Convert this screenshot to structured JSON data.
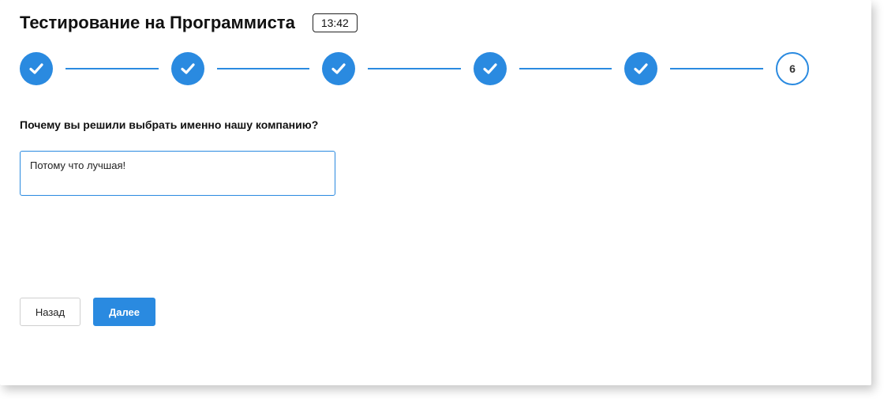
{
  "header": {
    "title": "Тестирование на Программиста",
    "timer": "13:42"
  },
  "stepper": {
    "steps": [
      {
        "state": "done",
        "icon": "check-icon"
      },
      {
        "state": "done",
        "icon": "check-icon"
      },
      {
        "state": "done",
        "icon": "check-icon"
      },
      {
        "state": "done",
        "icon": "check-icon"
      },
      {
        "state": "done",
        "icon": "check-icon"
      },
      {
        "state": "current",
        "label": "6"
      }
    ],
    "accent_color": "#2a8ae0"
  },
  "question": {
    "text": "Почему вы решили выбрать именно нашу компанию?",
    "answer_value": "Потому что лучшая!"
  },
  "buttons": {
    "back_label": "Назад",
    "next_label": "Далее"
  }
}
